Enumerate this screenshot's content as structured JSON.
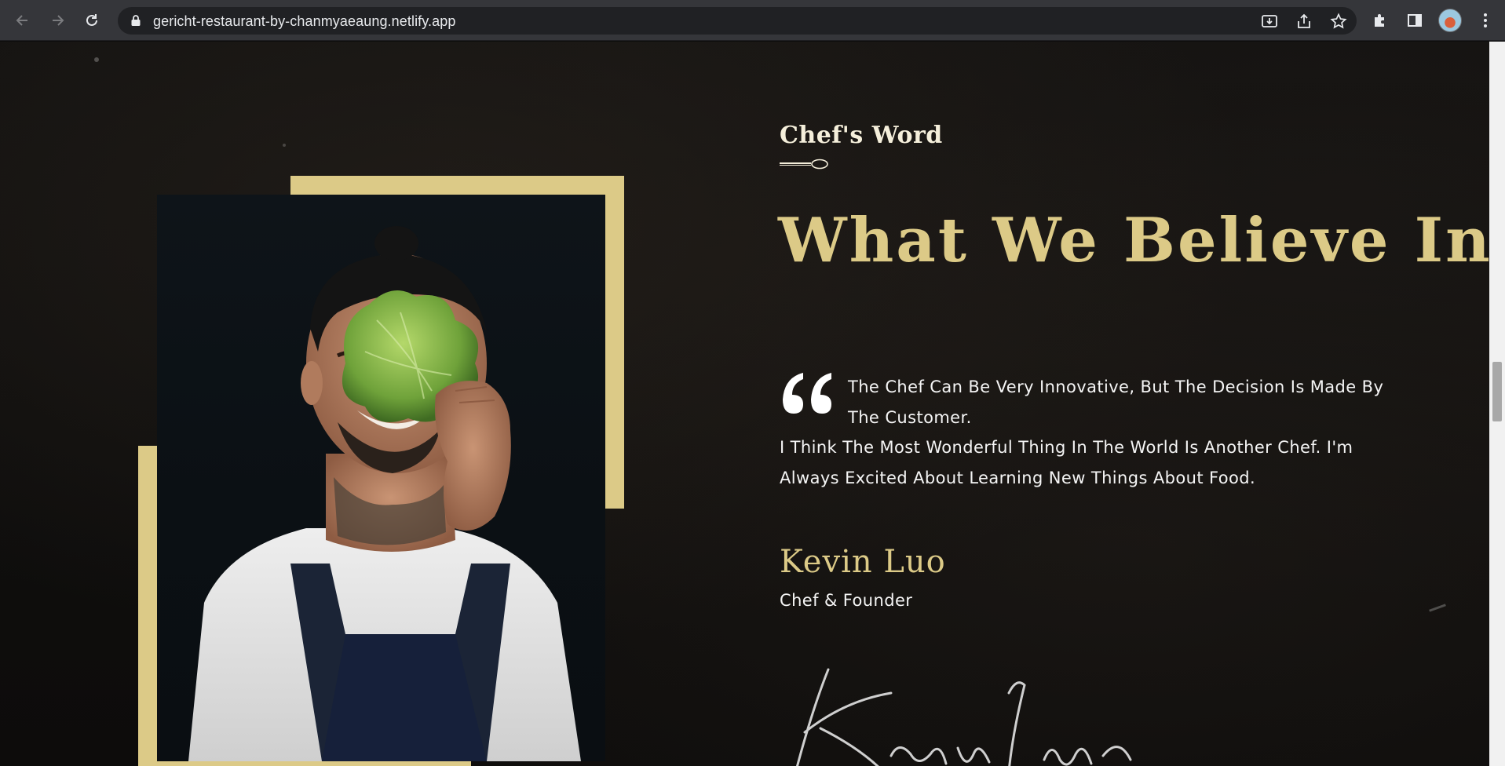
{
  "browser": {
    "url": "gericht-restaurant-by-chanmyaeaung.netlify.app",
    "icons": [
      "back-arrow-icon",
      "forward-arrow-icon",
      "reload-icon",
      "lock-icon",
      "install-app-icon",
      "share-icon",
      "bookmark-star-icon",
      "extensions-puzzle-icon",
      "side-panel-icon",
      "profile-avatar",
      "kebab-menu-icon"
    ]
  },
  "section": {
    "subtitle": "Chef's Word",
    "headline": "What We Believe In",
    "quote_first": "The Chef Can Be Very Innovative, But The Decision Is Made By The Customer.",
    "quote_second": "I Think The Most Wonderful Thing In The World Is Another Chef. I'm Always Excited About Learning New Things About Food.",
    "chef_name": "Kevin Luo",
    "chef_role": "Chef & Founder"
  },
  "colors": {
    "gold": "#dcca87",
    "background": "#0c0c0c",
    "text": "#f5f5f5"
  }
}
